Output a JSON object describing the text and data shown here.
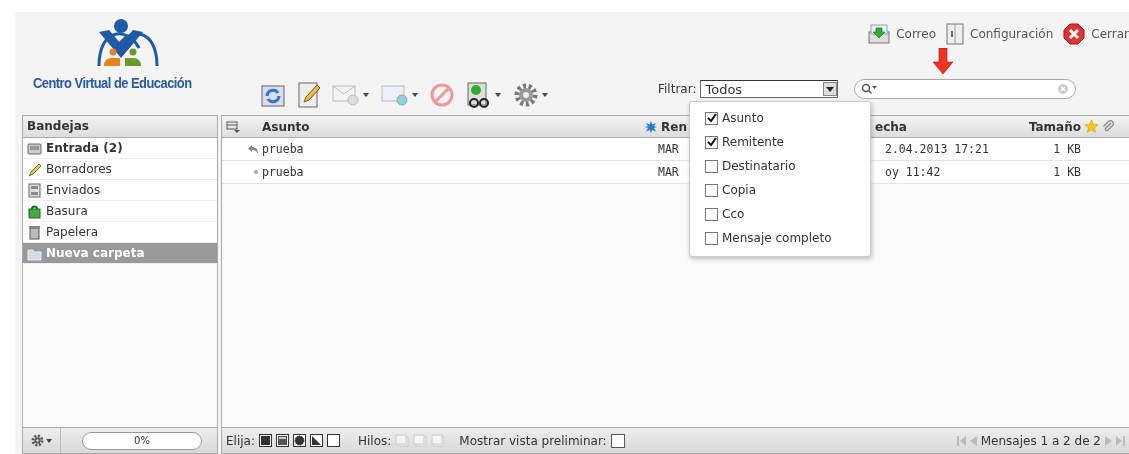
{
  "top_links": [
    {
      "label": "Correo",
      "kind": "mail"
    },
    {
      "label": "Configuración",
      "kind": "settings"
    },
    {
      "label": "Cerrar",
      "kind": "logout"
    }
  ],
  "logo": {
    "text": "Centro Virtual de Educación"
  },
  "filter": {
    "label": "Filtrar:",
    "value": "Todos"
  },
  "folders": {
    "title": "Bandejas",
    "items": [
      {
        "label": "Entrada (2)",
        "kind": "inbox",
        "unread": true,
        "selected": false
      },
      {
        "label": "Borradores",
        "kind": "drafts",
        "unread": false,
        "selected": false
      },
      {
        "label": "Enviados",
        "kind": "sent",
        "unread": false,
        "selected": false
      },
      {
        "label": "Basura",
        "kind": "junk",
        "unread": false,
        "selected": false
      },
      {
        "label": "Papelera",
        "kind": "trash",
        "unread": false,
        "selected": false
      },
      {
        "label": "Nueva carpeta",
        "kind": "folder",
        "unread": false,
        "selected": true
      }
    ]
  },
  "quota": {
    "reading": "0%",
    "level": 0
  },
  "messages": {
    "columns": [
      {
        "label": "Asunto"
      },
      {
        "label": "Ren"
      },
      {
        "label": "echa"
      },
      {
        "label": "Tamaño"
      }
    ],
    "rows": [
      {
        "kind": "replied",
        "subject": "prueba",
        "sender": "MAR",
        "date": "2.04.2013 17:21",
        "size": "1 KB"
      },
      {
        "kind": "read",
        "subject": "prueba",
        "sender": "MAR",
        "date": "oy 11:42",
        "size": "1 KB"
      }
    ]
  },
  "filter_menu": [
    {
      "label": "Asunto",
      "checked": true
    },
    {
      "label": "Remitente",
      "checked": true
    },
    {
      "label": "Destinatario",
      "checked": false
    },
    {
      "label": "Copia",
      "checked": false
    },
    {
      "label": "Cco",
      "checked": false
    },
    {
      "label": "Mensaje completo",
      "checked": false
    }
  ],
  "footer": {
    "select_label": "Elija:",
    "threads_label": "Hilos:",
    "preview_label": "Mostrar vista preliminar:",
    "preview_checked": false,
    "count": "Mensajes 1 a 2 de 2"
  }
}
